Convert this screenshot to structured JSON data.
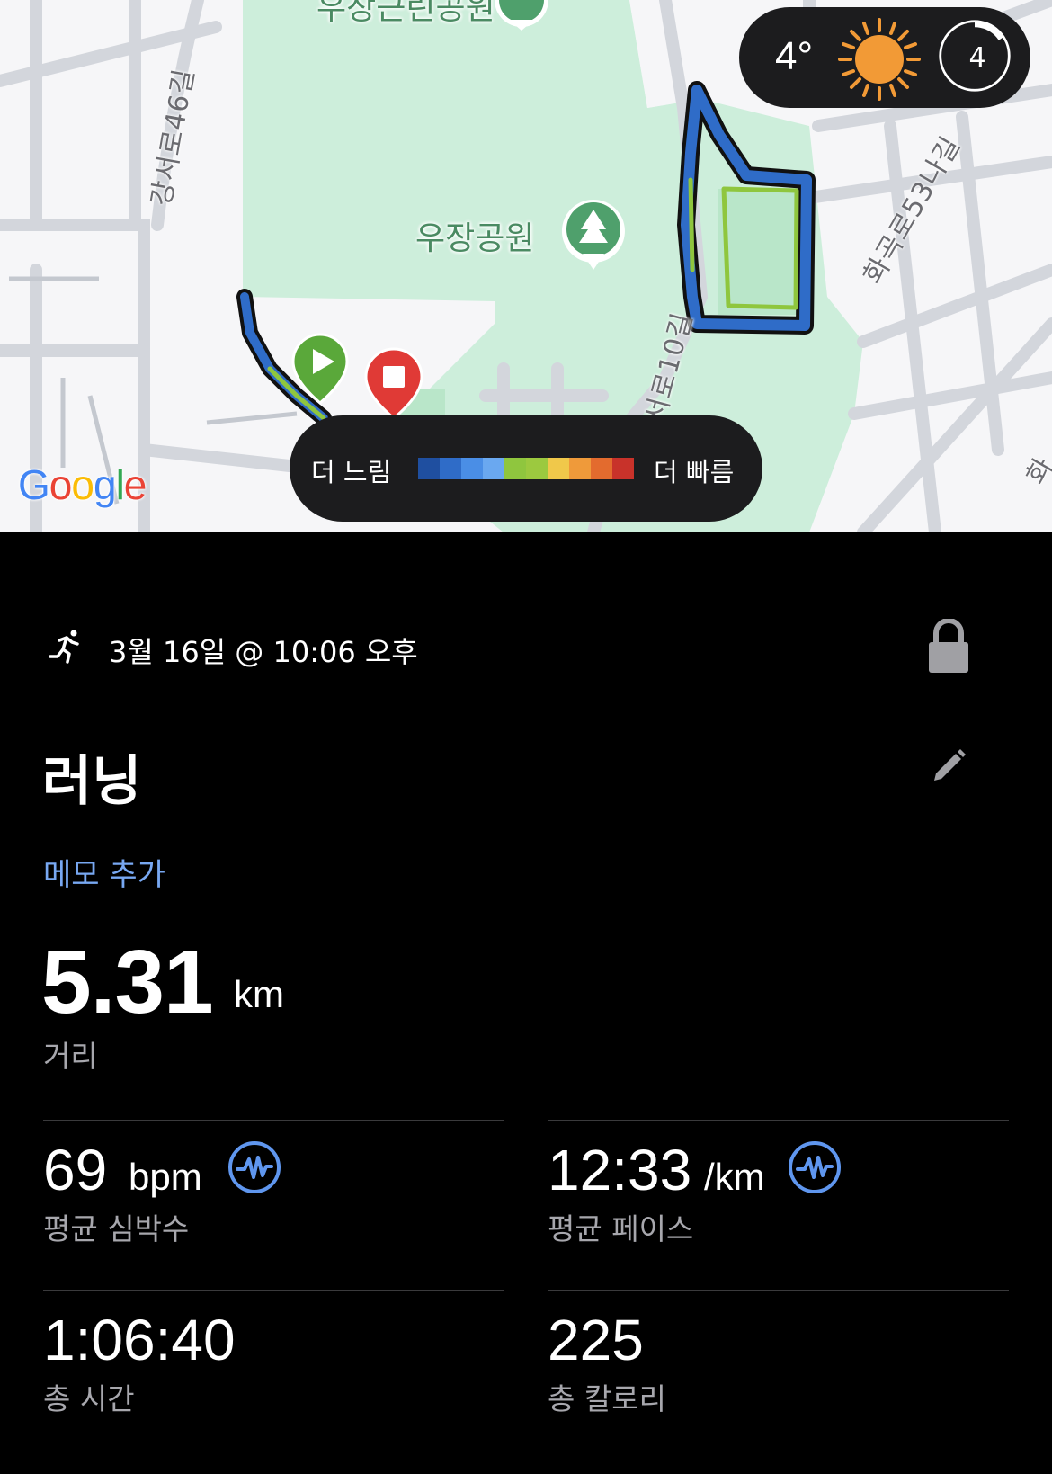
{
  "map": {
    "road_labels": [
      "강서로46길",
      "화곡로53나길",
      "강서로10길",
      "화"
    ],
    "park_top_label": "우장근린공원",
    "park_label": "우장공원",
    "attribution": "Google",
    "weather": {
      "temp": "4°",
      "uv_index": "4",
      "icon": "sun-icon"
    },
    "legend": {
      "slow_label": "더 느림",
      "fast_label": "더 빠름",
      "colors": [
        "#1f4fa0",
        "#2f6cc8",
        "#4a8ee6",
        "#6aa8f0",
        "#8fc63e",
        "#9cc93f",
        "#f0c84a",
        "#ef9a3a",
        "#e36b2e",
        "#c8322a"
      ]
    },
    "markers": {
      "start_icon": "play-icon",
      "end_icon": "stop-icon"
    }
  },
  "activity": {
    "icon": "running-icon",
    "date": "3월 16일 @ 10:06 오후",
    "title": "러닝",
    "memo_link": "메모 추가",
    "distance": {
      "value": "5.31",
      "unit": "km",
      "label": "거리"
    },
    "stats": [
      {
        "value": "69",
        "unit": "bpm",
        "label": "평균 심박수",
        "icon": "heart-pulse-icon"
      },
      {
        "value": "12:33",
        "unit": "/km",
        "label": "평균 페이스",
        "icon": "heart-pulse-icon"
      },
      {
        "value": "1:06:40",
        "unit": "",
        "label": "총 시간"
      },
      {
        "value": "225",
        "unit": "",
        "label": "총 칼로리"
      }
    ]
  },
  "colors": {
    "accent_link": "#78a8f2",
    "park_green": "#cdeedb",
    "route_blue": "#2f6cc8",
    "start_green": "#5aa83a",
    "stop_red": "#e03a36"
  }
}
